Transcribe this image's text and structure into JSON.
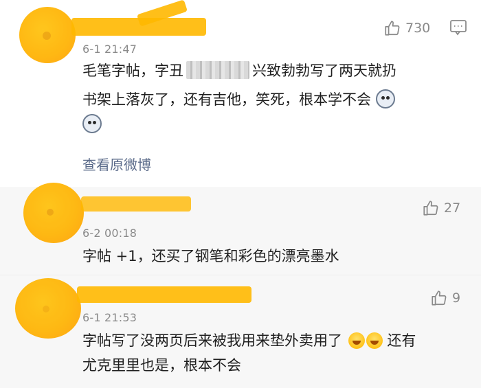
{
  "comments": [
    {
      "likes": "730",
      "timestamp": "6-1 21:47",
      "line1_a": "毛笔字帖，字丑",
      "line1_b": "兴致勃勃写了两天就扔",
      "line2": "书架上落灰了，还有吉他，笑死，根本学不会",
      "link": "查看原微博"
    },
    {
      "likes": "27",
      "timestamp": "6-2 00:18",
      "line1": "字帖 +1，还买了钢笔和彩色的漂亮墨水"
    },
    {
      "likes": "9",
      "timestamp": "6-1 21:53",
      "line1": "字帖写了没两页后来被我用来垫外卖用了",
      "line1_tail": "还有",
      "line2": "尤克里里也是，根本不会"
    }
  ],
  "icons": {
    "like": "thumbs-up-icon",
    "reply": "comment-bubble-icon",
    "emoji_dog": "husky-emoji",
    "emoji_laugh": "laugh-cry-emoji"
  },
  "colors": {
    "avatar_overlay": "#ffb300",
    "link": "#5b6b8a",
    "meta_text": "#8a8a8a"
  }
}
